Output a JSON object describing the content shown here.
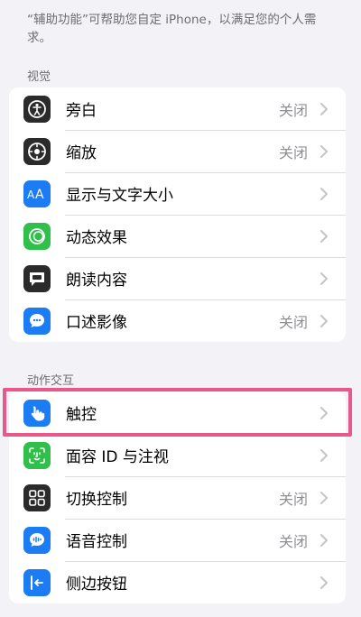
{
  "intro_text": "“辅助功能”可帮助您自定 iPhone，以满足您的个人需求。",
  "sections": [
    {
      "header": "视觉",
      "rows": [
        {
          "label": "旁白",
          "value": "关闭",
          "icon": "voiceover-icon",
          "color": "#2b2b2b"
        },
        {
          "label": "缩放",
          "value": "关闭",
          "icon": "zoom-icon",
          "color": "#2b2b2b"
        },
        {
          "label": "显示与文字大小",
          "value": "",
          "icon": "text-size-icon",
          "color": "#1c7cf4"
        },
        {
          "label": "动态效果",
          "value": "",
          "icon": "motion-icon",
          "color": "#2fbf4a"
        },
        {
          "label": "朗读内容",
          "value": "",
          "icon": "spoken-content-icon",
          "color": "#2b2b2b"
        },
        {
          "label": "口述影像",
          "value": "关闭",
          "icon": "audio-description-icon",
          "color": "#1c7cf4"
        }
      ]
    },
    {
      "header": "动作交互",
      "rows": [
        {
          "label": "触控",
          "value": "",
          "icon": "touch-icon",
          "color": "#1c7cf4"
        },
        {
          "label": "面容 ID 与注视",
          "value": "",
          "icon": "face-id-icon",
          "color": "#2fbf4a"
        },
        {
          "label": "切换控制",
          "value": "关闭",
          "icon": "switch-control-icon",
          "color": "#2b2b2b"
        },
        {
          "label": "语音控制",
          "value": "关闭",
          "icon": "voice-control-icon",
          "color": "#1c7cf4"
        },
        {
          "label": "侧边按钮",
          "value": "",
          "icon": "side-button-icon",
          "color": "#1c7cf4"
        }
      ]
    }
  ],
  "highlight_color": "#e8588a"
}
